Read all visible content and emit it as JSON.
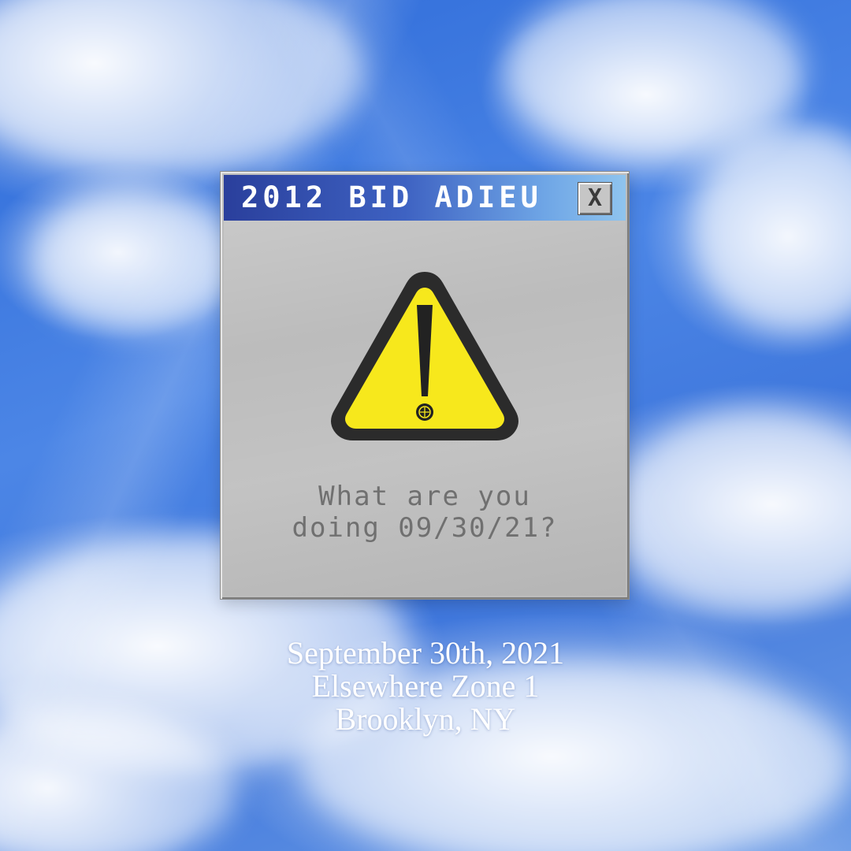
{
  "window": {
    "title": "2012 BID ADIEU",
    "close_label": "X",
    "icon": "warning-icon",
    "message_line1": "What are you",
    "message_line2": "doing 09/30/21?",
    "titlebar_colors": [
      "#2a3f9c",
      "#8fc4ee"
    ],
    "warning_color": "#f7e81c"
  },
  "event": {
    "date": "September 30th, 2021",
    "venue": "Elsewhere Zone 1",
    "location": "Brooklyn, NY"
  }
}
